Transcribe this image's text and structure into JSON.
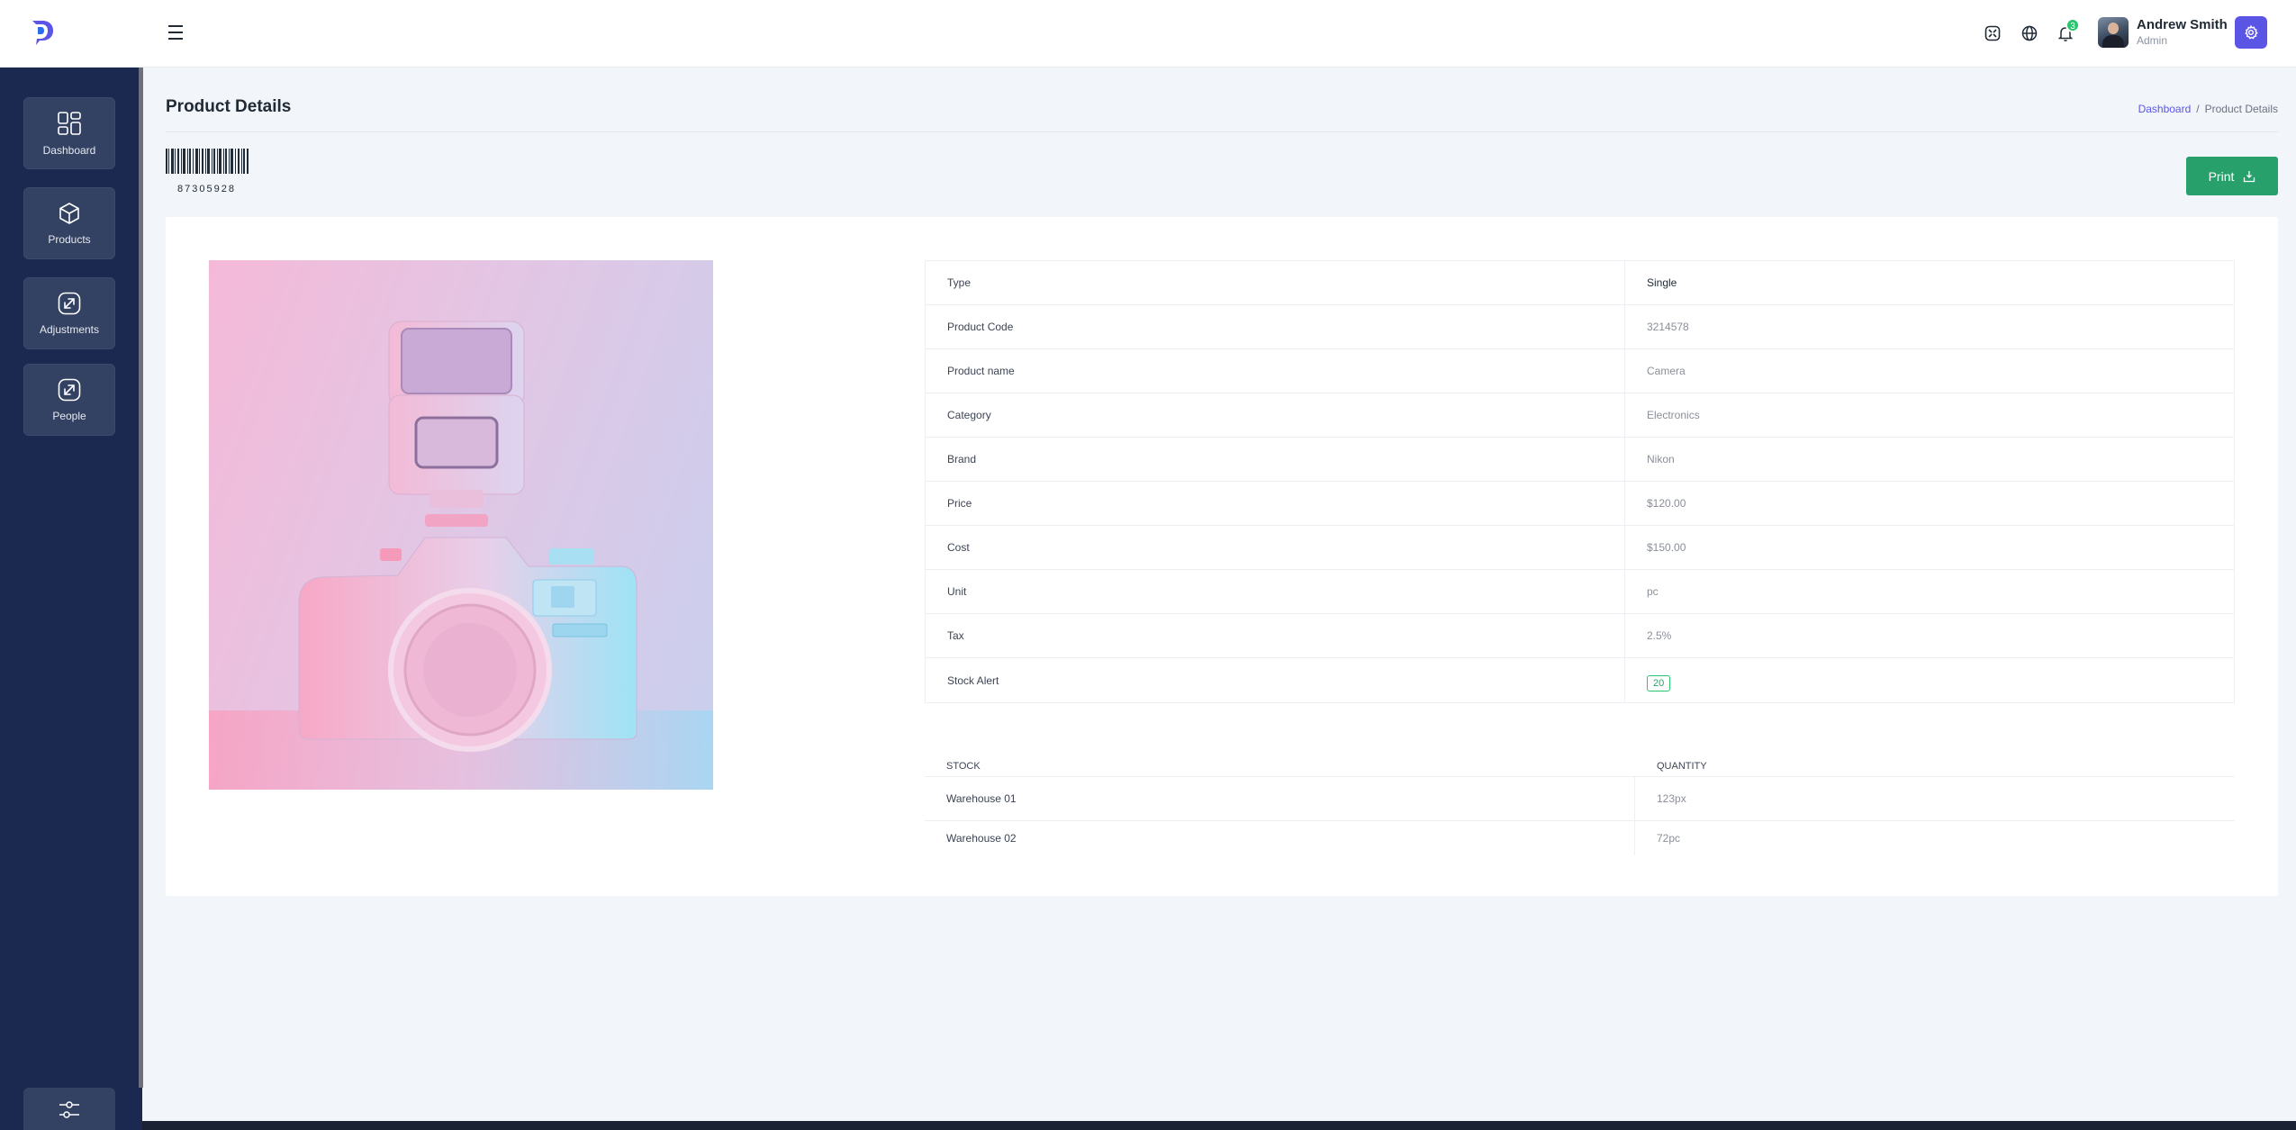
{
  "header": {
    "user_name": "Andrew Smith",
    "user_role": "Admin",
    "notification_count": "3"
  },
  "sidebar": {
    "items": [
      {
        "label": "Dashboard",
        "icon": "dashboard-icon"
      },
      {
        "label": "Products",
        "icon": "box-icon"
      },
      {
        "label": "Adjustments",
        "icon": "arrows-icon"
      },
      {
        "label": "People",
        "icon": "arrows-icon"
      }
    ]
  },
  "page": {
    "title": "Product Details",
    "breadcrumb_link": "Dashboard",
    "breadcrumb_sep": "/",
    "breadcrumb_current": "Product Details",
    "barcode_number": "87305928",
    "print_label": "Print"
  },
  "details": [
    {
      "label": "Type",
      "value": "Single"
    },
    {
      "label": "Product Code",
      "value": "3214578"
    },
    {
      "label": "Product name",
      "value": "Camera"
    },
    {
      "label": "Category",
      "value": "Electronics"
    },
    {
      "label": "Brand",
      "value": "Nikon"
    },
    {
      "label": "Price",
      "value": "$120.00"
    },
    {
      "label": "Cost",
      "value": "$150.00"
    },
    {
      "label": "Unit",
      "value": "pc"
    },
    {
      "label": "Tax",
      "value": "2.5%"
    },
    {
      "label": "Stock Alert",
      "value": "20"
    }
  ],
  "stock": {
    "col_stock": "STOCK",
    "col_quantity": "QUANTITY",
    "rows": [
      {
        "warehouse": "Warehouse 01",
        "quantity": "123px"
      },
      {
        "warehouse": "Warehouse 02",
        "quantity": "72pc"
      }
    ]
  },
  "colors": {
    "accent": "#5b55e6",
    "success": "#28a06b",
    "sidebar": "#1b2850"
  }
}
